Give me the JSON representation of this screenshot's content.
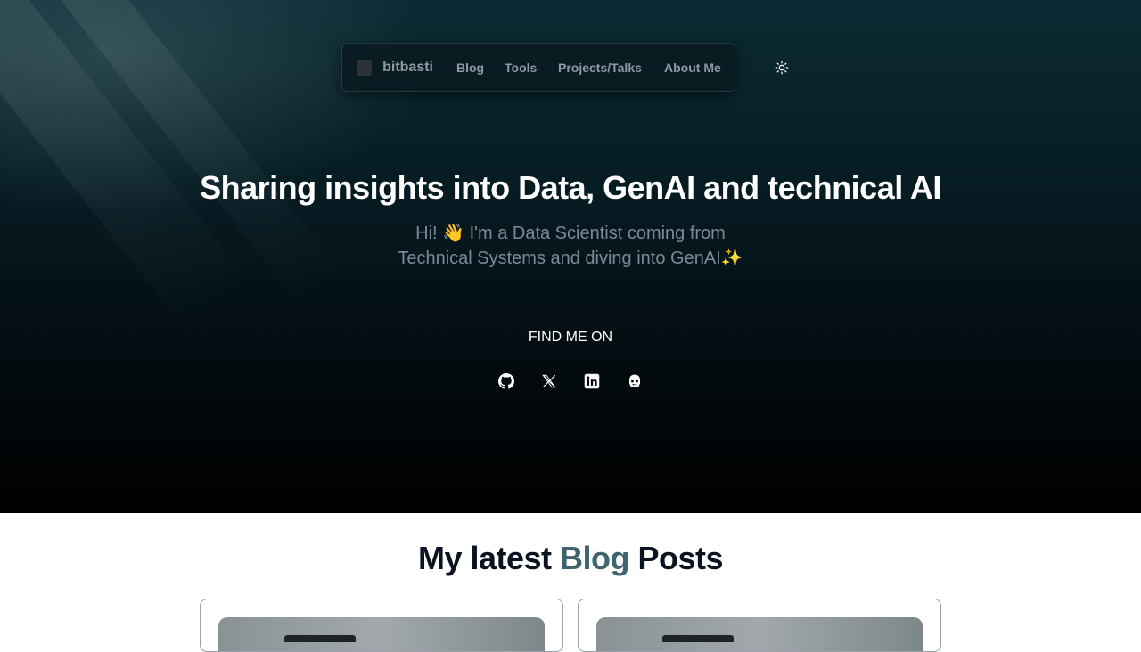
{
  "nav": {
    "brand": "bitbasti",
    "items": [
      {
        "label": "Blog"
      },
      {
        "label": "Tools"
      },
      {
        "label": "Projects/Talks"
      },
      {
        "label": "About Me"
      }
    ],
    "theme_toggle_icon": "sun-icon"
  },
  "hero": {
    "headline": "Sharing insights into Data, GenAI and technical AI",
    "intro_line1": "Hi! 👋 I'm a Data Scientist coming from",
    "intro_line2": "Technical Systems and diving into GenAI✨",
    "find_label": "FIND ME ON",
    "socials": [
      {
        "icon": "github-icon"
      },
      {
        "icon": "x-icon"
      },
      {
        "icon": "linkedin-icon"
      },
      {
        "icon": "stormtrooper-icon"
      }
    ]
  },
  "blog": {
    "title_prefix": "My latest ",
    "title_accent": "Blog",
    "title_suffix": " Posts",
    "accent_color": "#3e6470"
  }
}
